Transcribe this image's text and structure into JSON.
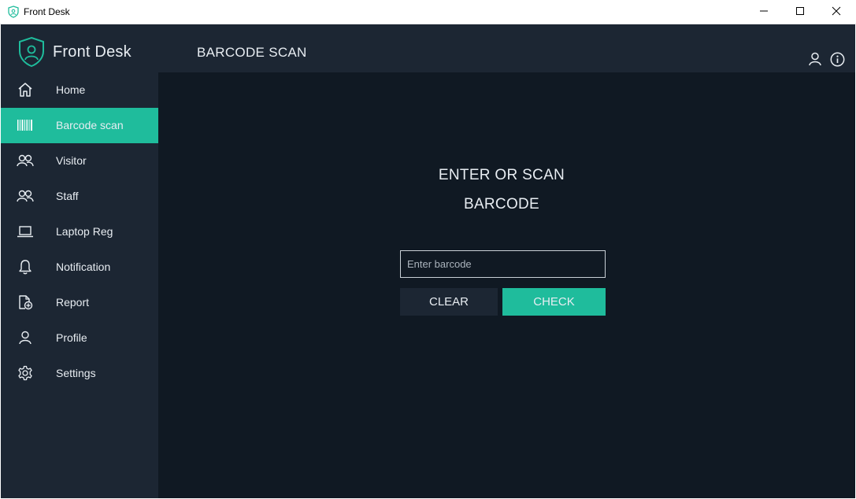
{
  "window": {
    "title": "Front Desk",
    "icon": "shield-user-icon",
    "controls": [
      "minimize-icon",
      "maximize-icon",
      "close-icon"
    ]
  },
  "header": {
    "brand_name": "Front Desk",
    "brand_icon": "shield-user-icon",
    "page_title": "BARCODE SCAN",
    "icons": [
      "user-icon",
      "info-icon"
    ]
  },
  "sidebar": {
    "items": [
      {
        "label": "Home",
        "icon": "home-icon",
        "active": false
      },
      {
        "label": "Barcode scan",
        "icon": "barcode-icon",
        "active": true
      },
      {
        "label": "Visitor",
        "icon": "users-icon",
        "active": false
      },
      {
        "label": "Staff",
        "icon": "users-icon",
        "active": false
      },
      {
        "label": "Laptop Reg",
        "icon": "laptop-icon",
        "active": false
      },
      {
        "label": "Notification",
        "icon": "bell-icon",
        "active": false
      },
      {
        "label": "Report",
        "icon": "report-add-icon",
        "active": false
      },
      {
        "label": "Profile",
        "icon": "user-icon",
        "active": false
      },
      {
        "label": "Settings",
        "icon": "gear-icon",
        "active": false
      }
    ]
  },
  "main": {
    "heading_line1": "ENTER OR SCAN",
    "heading_line2": "BARCODE",
    "barcode_input": {
      "value": "",
      "placeholder": "Enter barcode"
    },
    "clear_label": "CLEAR",
    "check_label": "CHECK"
  },
  "colors": {
    "accent": "#1fbc9c",
    "panel": "#1c2633",
    "background": "#101923",
    "text": "#e8edf2"
  }
}
